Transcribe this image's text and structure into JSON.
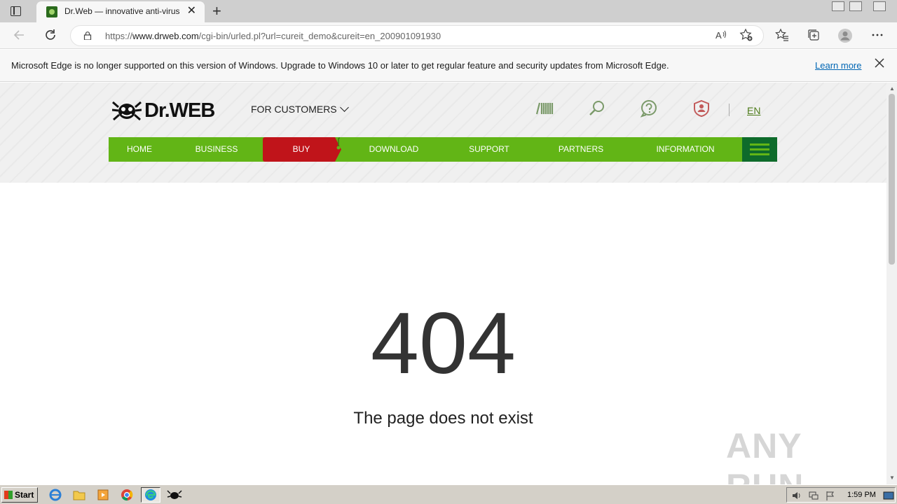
{
  "browser": {
    "tab_title": "Dr.Web — innovative anti-virus",
    "tab_close": "✕",
    "new_tab": "+",
    "url_prefix": "https://",
    "url_host": "www.drweb.com",
    "url_path": "/cgi-bin/urled.pl?url=cureit_demo&cureit=en_200901091930"
  },
  "infobar": {
    "message": "Microsoft Edge is no longer supported on this version of Windows. Upgrade to Windows 10 or later to get regular feature and security updates from Microsoft Edge.",
    "learn_more": "Learn more"
  },
  "site": {
    "logo_text": "Dr.WEB",
    "for_customers": "FOR CUSTOMERS",
    "language": "EN",
    "nav": {
      "home": "HOME",
      "business": "BUSINESS",
      "buy": "BUY",
      "download": "DOWNLOAD",
      "support": "SUPPORT",
      "partners": "PARTNERS",
      "information": "INFORMATION"
    },
    "colors": {
      "nav_green": "#62b516",
      "buy_red": "#c0141a",
      "burger_dark": "#0e6b2b"
    }
  },
  "error": {
    "code": "404",
    "message": "The page does not exist"
  },
  "watermark": "ANY RUN",
  "taskbar": {
    "start_label": "Start",
    "clock": "1:59 PM"
  }
}
